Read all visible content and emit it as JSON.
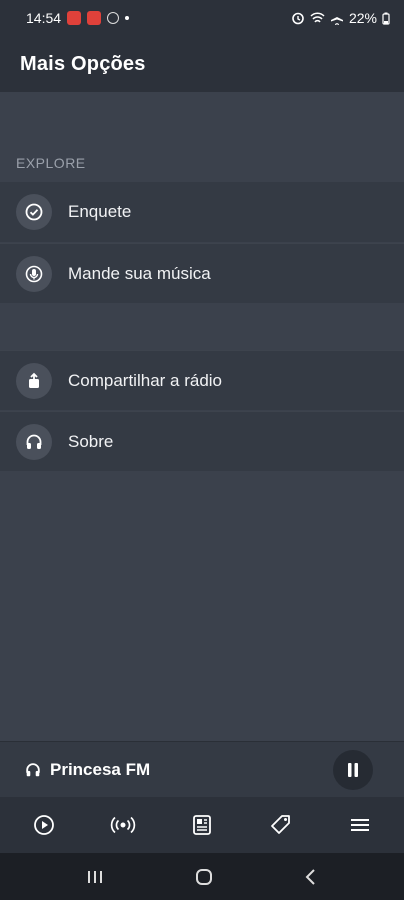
{
  "status_bar": {
    "time": "14:54",
    "battery": "22%"
  },
  "header": {
    "title": "Mais Opções"
  },
  "sections": {
    "explore_label": "EXPLORE",
    "explore_items": [
      {
        "label": "Enquete",
        "icon": "check-circle-icon"
      },
      {
        "label": "Mande sua música",
        "icon": "microphone-icon"
      }
    ],
    "other_items": [
      {
        "label": "Compartilhar a rádio",
        "icon": "share-icon"
      },
      {
        "label": "Sobre",
        "icon": "headphones-icon"
      }
    ]
  },
  "player": {
    "station": "Princesa FM",
    "state": "playing"
  },
  "tabs": [
    "play-icon",
    "broadcast-icon",
    "news-icon",
    "tag-icon",
    "menu-icon"
  ],
  "colors": {
    "background": "#3b414c",
    "header": "#2c313a",
    "item": "#343a44"
  }
}
